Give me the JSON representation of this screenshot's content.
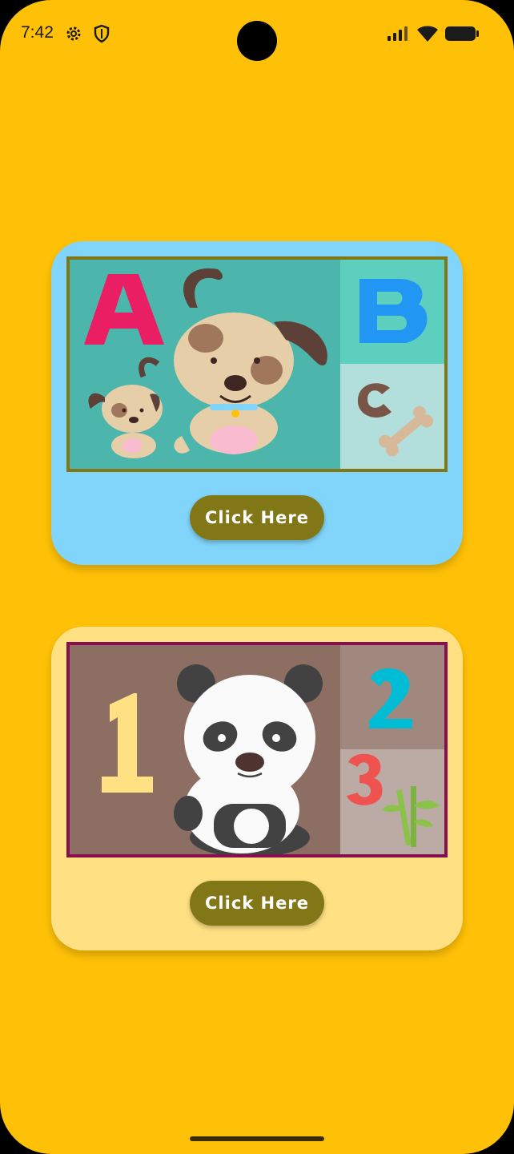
{
  "status_bar": {
    "time": "7:42",
    "icons_left": [
      "gear-icon",
      "shield-icon"
    ],
    "icons_right": [
      "signal-icon",
      "wifi-icon",
      "battery-icon"
    ]
  },
  "cards": [
    {
      "illustration": {
        "letters": [
          "A",
          "B",
          "C"
        ],
        "subject": "puppy-icon",
        "extra": "bone-icon",
        "colors": {
          "background": "#4DB6AC",
          "border": "#827717",
          "a": "#E91E63",
          "b": "#2196F3",
          "c": "#795548"
        }
      },
      "button_label": "Click Here"
    },
    {
      "illustration": {
        "numbers": [
          "1",
          "2",
          "3"
        ],
        "subject": "panda-icon",
        "extra": "bamboo-icon",
        "colors": {
          "background": "#8D6E63",
          "border": "#880E4F",
          "one": "#FFE082",
          "two": "#00BCD4",
          "three": "#EF5350"
        }
      },
      "button_label": "Click Here"
    }
  ],
  "colors": {
    "screen_background": "#FFC107",
    "card_1_background": "#81D4FA",
    "card_2_background": "#FFE082",
    "button_background": "#827717"
  }
}
